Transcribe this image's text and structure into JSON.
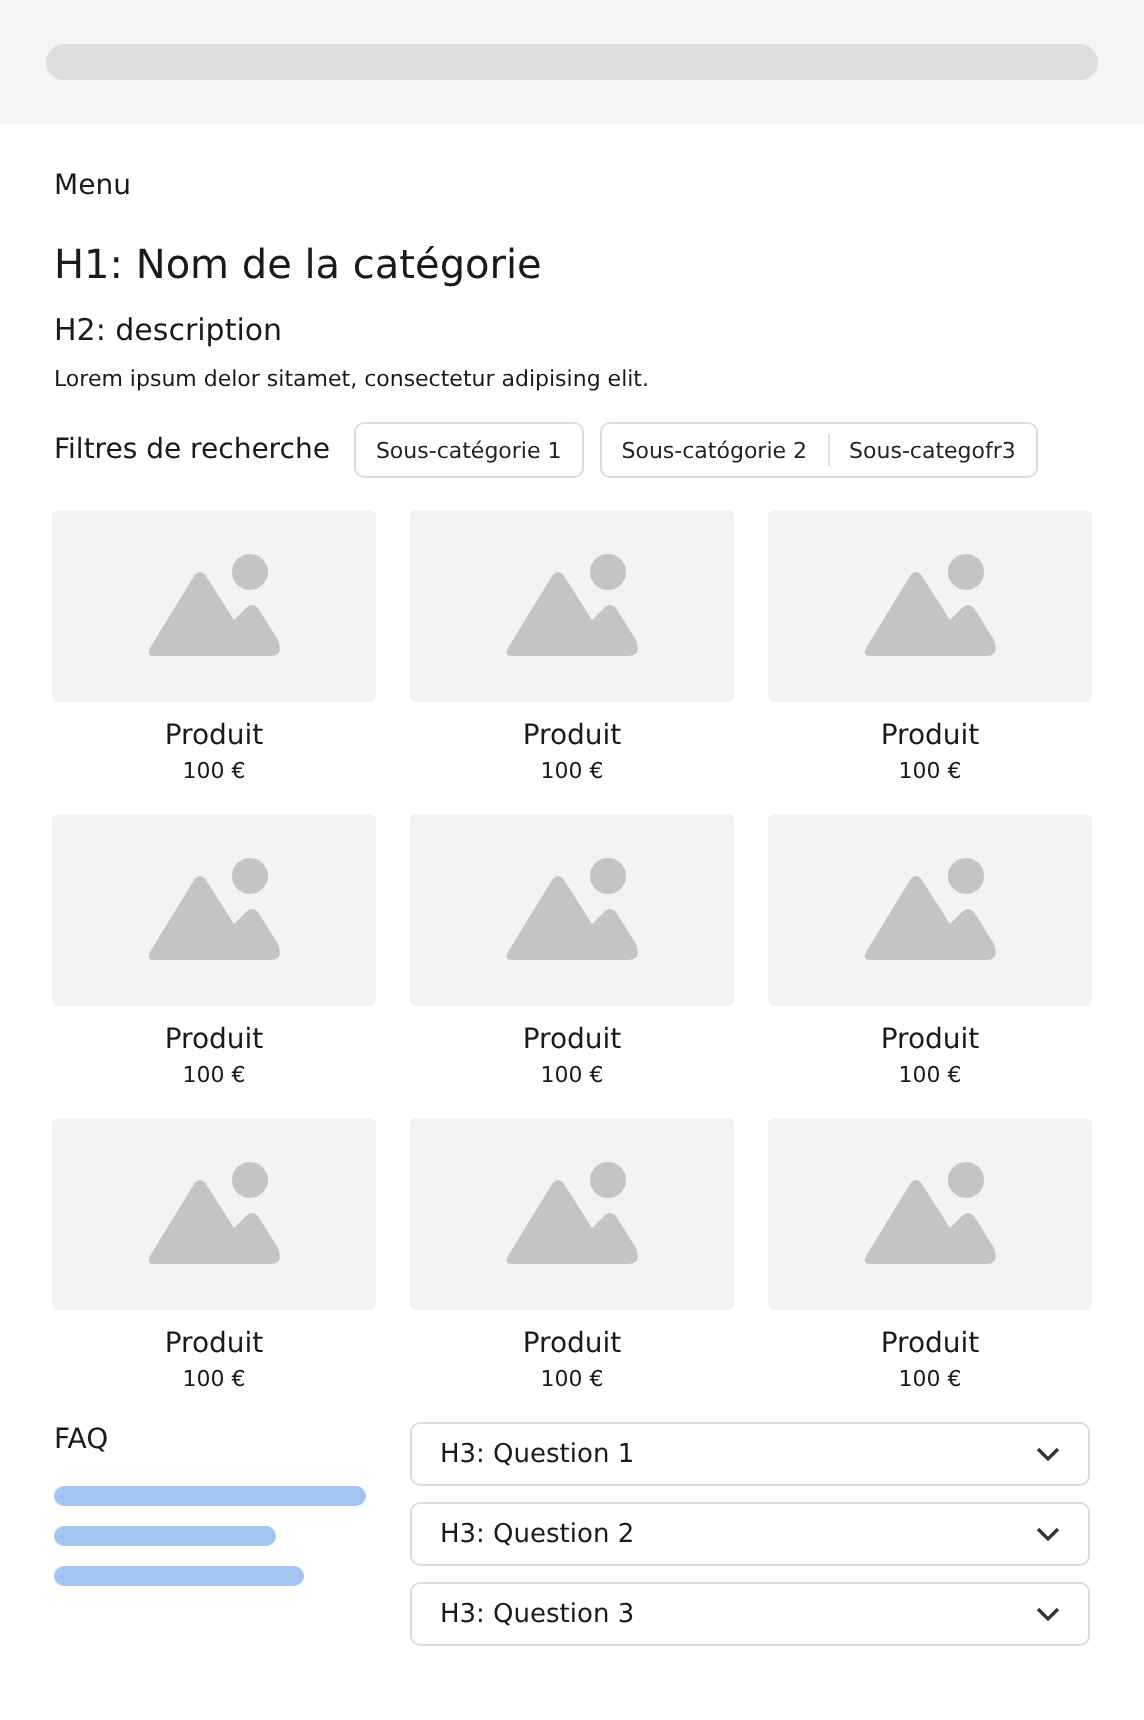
{
  "menu": "Menu",
  "title": "H1: Nom de la catégorie",
  "subtitle": "H2: description",
  "description": "Lorem ipsum delor sitamet, consectetur adipising elit.",
  "filters": {
    "label": "Filtres de recherche",
    "chip_groups": [
      {
        "chips": [
          {
            "label": "Sous-catégorie 1"
          }
        ]
      },
      {
        "chips": [
          {
            "label": "Sous-catógorie 2"
          },
          {
            "label": "Sous-categofr3"
          }
        ]
      }
    ]
  },
  "products": [
    {
      "name": "Produit",
      "price": "100 €"
    },
    {
      "name": "Produit",
      "price": "100 €"
    },
    {
      "name": "Produit",
      "price": "100 €"
    },
    {
      "name": "Produit",
      "price": "100 €"
    },
    {
      "name": "Produit",
      "price": "100 €"
    },
    {
      "name": "Produit",
      "price": "100 €"
    },
    {
      "name": "Produit",
      "price": "100 €"
    },
    {
      "name": "Produit",
      "price": "100 €"
    },
    {
      "name": "Produit",
      "price": "100 €"
    }
  ],
  "faq": {
    "title": "FAQ",
    "questions": [
      {
        "label": "H3: Question 1",
        "expanded": false
      },
      {
        "label": "H3: Question 2",
        "expanded": false
      },
      {
        "label": "H3: Question 3",
        "expanded": false
      }
    ]
  }
}
